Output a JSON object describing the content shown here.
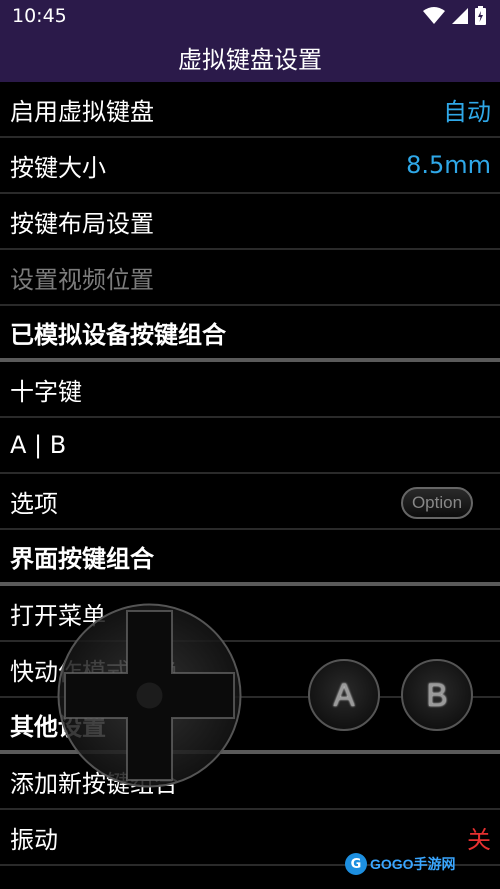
{
  "status": {
    "time": "10:45"
  },
  "title": "虚拟键盘设置",
  "rows": [
    {
      "label": "启用虚拟键盘",
      "value": "自动"
    },
    {
      "label": "按键大小",
      "value": "8.5mm"
    },
    {
      "label": "按键布局设置"
    },
    {
      "label": "设置视频位置"
    },
    {
      "label": "已模拟设备按键组合"
    },
    {
      "label": "十字键"
    },
    {
      "label": "A | B"
    },
    {
      "label": "选项",
      "option_label": "Option"
    },
    {
      "label": "界面按键组合"
    },
    {
      "label": "打开菜单"
    },
    {
      "label": "快动作模式切换"
    },
    {
      "label": "其他设置"
    },
    {
      "label": "添加新按键组合"
    },
    {
      "label": "振动",
      "value": "关"
    }
  ],
  "overlay": {
    "button_a": "A",
    "button_b": "B"
  },
  "watermark": {
    "logo": "G",
    "text": "GOGO手游网"
  },
  "colors": {
    "accent": "#2fa8e8",
    "off": "#e53030",
    "titlebar": "#2b1a4a"
  }
}
